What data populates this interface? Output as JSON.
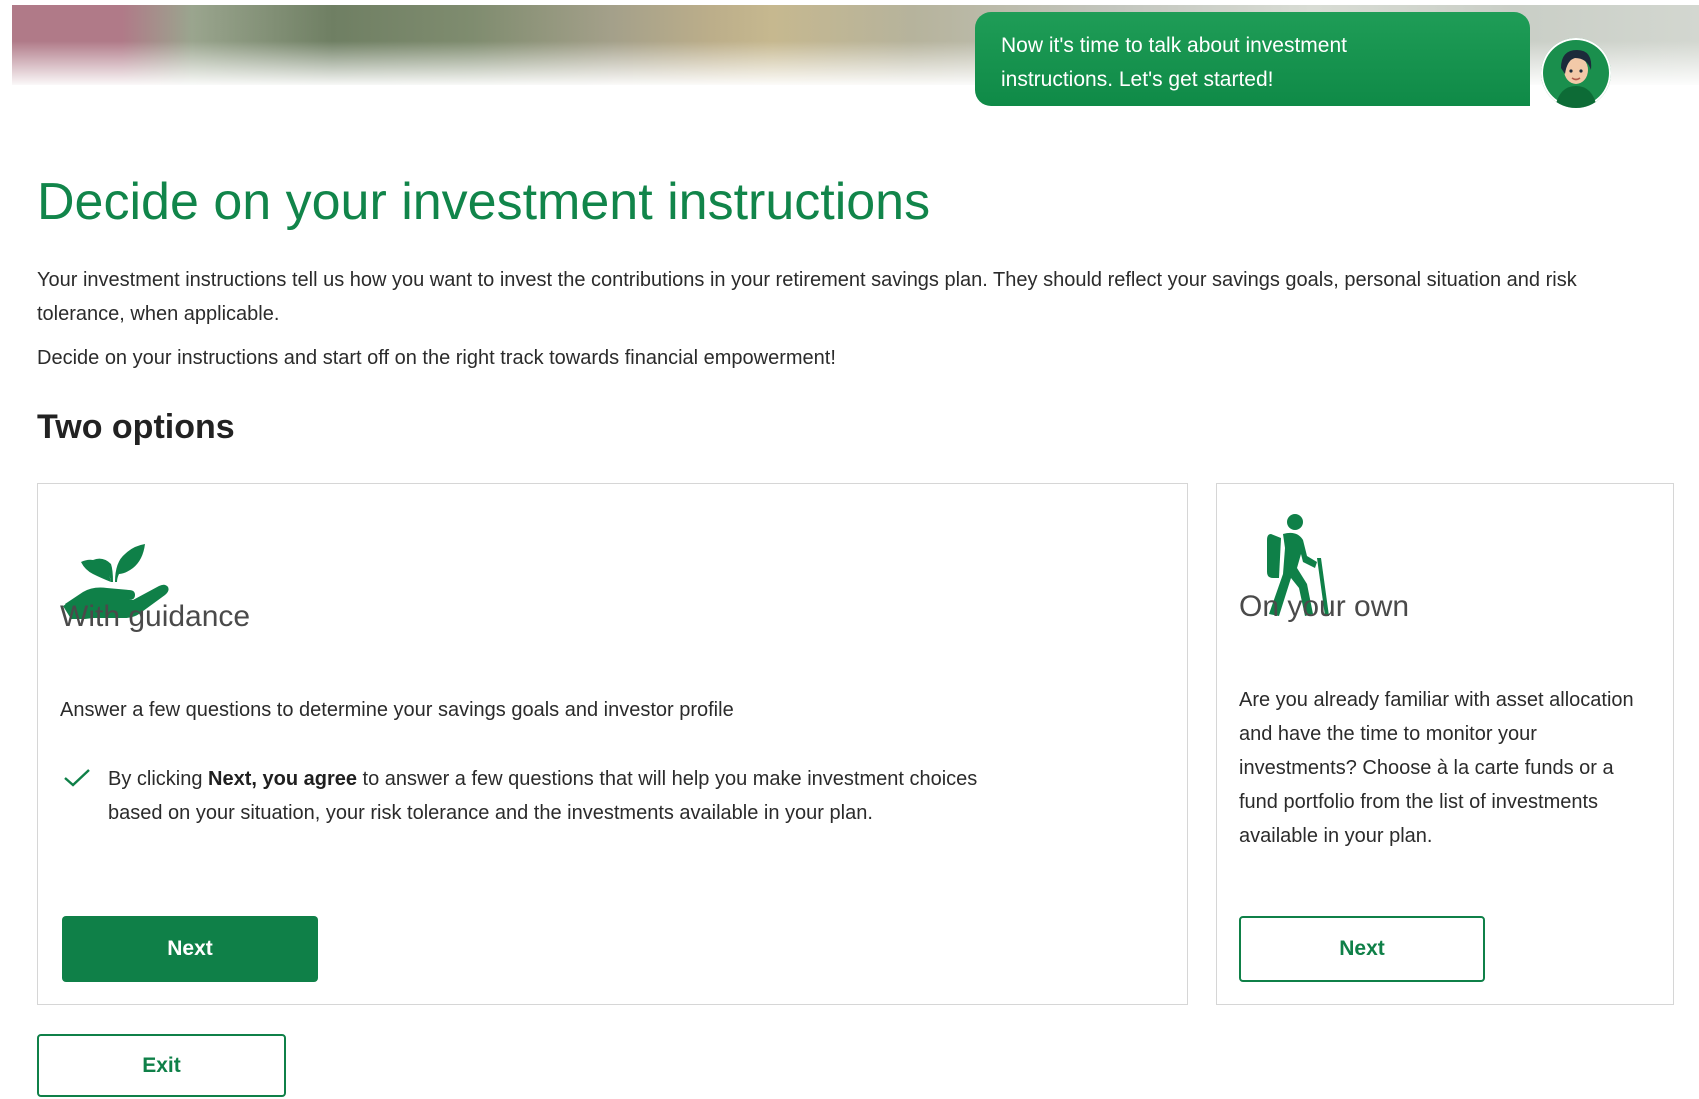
{
  "assistant": {
    "message_line1": "Now it's time to talk about investment",
    "message_line2": "instructions. Let's get started!"
  },
  "page": {
    "title": "Decide on your investment instructions",
    "intro": "Your investment instructions tell us how you want to invest the contributions in your retirement savings plan. They should reflect your savings goals, personal situation and risk tolerance, when applicable.",
    "intro2": "Decide on your instructions and start off on the right track towards financial empowerment!",
    "section_title": "Two options"
  },
  "options": {
    "guided": {
      "icon": "plant-in-hand-icon",
      "title": "With guidance",
      "description": "Answer a few questions to determine your savings goals and investor profile",
      "consent_prefix": "By clicking ",
      "consent_bold": "Next, you agree",
      "consent_rest": " to answer a few questions that will help you make investment choices based on your situation, your risk tolerance and the investments available in your plan.",
      "button_label": "Next"
    },
    "own": {
      "icon": "hiker-icon",
      "title": "On your own",
      "description": "Are you already familiar with asset allocation and have the time to monitor your investments? Choose à la carte funds or a fund portfolio from the list of investments available in your plan.",
      "button_label": "Next"
    }
  },
  "footer": {
    "exit_label": "Exit"
  },
  "colors": {
    "brand_green": "#0f8048",
    "title_green": "#11854a",
    "border": "#d6d6d6"
  }
}
